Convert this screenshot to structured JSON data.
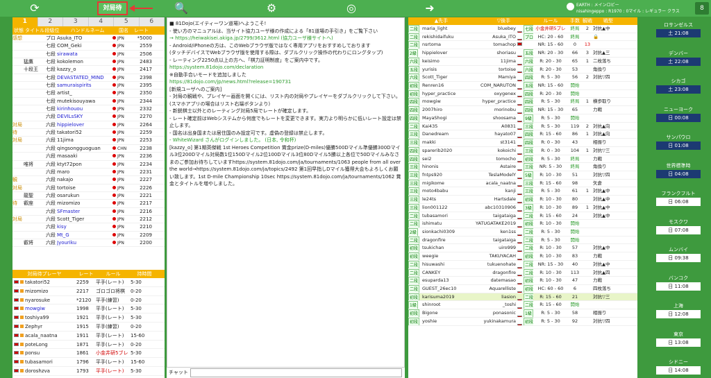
{
  "topbar": {
    "refresh_icon": "refresh-icon",
    "active_label": "対局待",
    "search_icon": "search-icon",
    "gear_icon": "gear-icon",
    "globe_icon": "globe-icon",
    "exit_icon": "exit-icon",
    "status_line1": "EARTH : メインロビー",
    "status_line2": "nisahingeppo : R1970 : 0マイル : レギュラー クラス",
    "lobby_badge": "8"
  },
  "left": {
    "tabs": [
      "1",
      "2",
      "3",
      "4",
      "5",
      "6"
    ],
    "headers": [
      "状態",
      "タイトル",
      "段級位",
      "ハンドルネーム",
      "国名",
      "レート"
    ],
    "players": [
      {
        "status": "感想",
        "title": "",
        "rank": "プロ",
        "name": "Asuka_ITO",
        "country": "JPN",
        "rate": "*5000",
        "blue": false
      },
      {
        "status": "",
        "title": "",
        "rank": "七段",
        "name": "COM_Geki",
        "country": "JPN",
        "rate": "2559",
        "blue": false
      },
      {
        "status": "",
        "title": "",
        "rank": "七段",
        "name": "sirawata",
        "country": "JPN",
        "rate": "2506",
        "blue": true
      },
      {
        "status": "",
        "title": "猛鷹",
        "rank": "七段",
        "name": "kokolemon",
        "country": "JPN",
        "rate": "2483",
        "blue": false
      },
      {
        "status": "",
        "title": "十段王",
        "rank": "七段",
        "name": "kazzy_o",
        "country": "JPN",
        "rate": "2417",
        "blue": false
      },
      {
        "status": "",
        "title": "",
        "rank": "七段",
        "name": "DEVASTATED_MIND",
        "country": "JPN",
        "rate": "2398",
        "blue": true
      },
      {
        "status": "",
        "title": "",
        "rank": "七段",
        "name": "samuraispirits",
        "country": "JPN",
        "rate": "2395",
        "blue": true
      },
      {
        "status": "",
        "title": "",
        "rank": "七段",
        "name": "artist_",
        "country": "JPN",
        "rate": "2350",
        "blue": false
      },
      {
        "status": "",
        "title": "",
        "rank": "七段",
        "name": "mutekisouyawa",
        "country": "JPN",
        "rate": "2344",
        "blue": false
      },
      {
        "status": "",
        "title": "",
        "rank": "七段",
        "name": "kirinhouou",
        "country": "JPN",
        "rate": "2332",
        "blue": true
      },
      {
        "status": "",
        "title": "",
        "rank": "六段",
        "name": "DEVILsSKY",
        "country": "JPN",
        "rate": "2270",
        "blue": true
      },
      {
        "status": "対局",
        "title": "",
        "rank": "六段",
        "name": "hippielover",
        "country": "JPN",
        "rate": "2264",
        "blue": true
      },
      {
        "status": "待",
        "title": "",
        "rank": "六段",
        "name": "takatori52",
        "country": "JPN",
        "rate": "2259",
        "blue": false
      },
      {
        "status": "対局",
        "title": "",
        "rank": "六段",
        "name": "11jima",
        "country": "JPN",
        "rate": "2253",
        "blue": false
      },
      {
        "status": "",
        "title": "",
        "rank": "六段",
        "name": "qingsongguoguan",
        "country": "CHN",
        "rate": "2238",
        "blue": false
      },
      {
        "status": "",
        "title": "",
        "rank": "六段",
        "name": "masaaki",
        "country": "JPN",
        "rate": "2236",
        "blue": false
      },
      {
        "status": "",
        "title": "唯将",
        "rank": "六段",
        "name": "ktyt72pon",
        "country": "JPN",
        "rate": "2234",
        "blue": false
      },
      {
        "status": "",
        "title": "",
        "rank": "六段",
        "name": "maro",
        "country": "JPN",
        "rate": "2231",
        "blue": false
      },
      {
        "status": "観",
        "title": "",
        "rank": "六段",
        "name": "nakajo",
        "country": "JPN",
        "rate": "2227",
        "blue": false
      },
      {
        "status": "対局",
        "title": "",
        "rank": "六段",
        "name": "tortoise",
        "country": "JPN",
        "rate": "2226",
        "blue": false
      },
      {
        "status": "",
        "title": "龍聖",
        "rank": "六段",
        "name": "osarukun",
        "country": "JPN",
        "rate": "2221",
        "blue": false
      },
      {
        "status": "待",
        "title": "叡座",
        "rank": "六段",
        "name": "mizomizo",
        "country": "JPN",
        "rate": "2217",
        "blue": false
      },
      {
        "status": "",
        "title": "",
        "rank": "六段",
        "name": "SFmaster",
        "country": "JPN",
        "rate": "2216",
        "blue": true
      },
      {
        "status": "対局",
        "title": "",
        "rank": "六段",
        "name": "Scott_Tiger",
        "country": "JPN",
        "rate": "2212",
        "blue": false
      },
      {
        "status": "",
        "title": "",
        "rank": "六段",
        "name": "kisy",
        "country": "JPN",
        "rate": "2210",
        "blue": true
      },
      {
        "status": "",
        "title": "",
        "rank": "六段",
        "name": "Mt_G",
        "country": "JPN",
        "rate": "2209",
        "blue": true
      },
      {
        "status": "",
        "title": "叡将",
        "rank": "六段",
        "name": "Jyouriku",
        "country": "JPN",
        "rate": "2200",
        "blue": true
      }
    ],
    "waiting_headers": [
      "対局待プレーヤ",
      "レート",
      "ルール",
      "持時間"
    ],
    "waiting": [
      {
        "name": "takatori52",
        "rate": "2259",
        "rule": "平手(レート)",
        "time": "5-30",
        "red": false,
        "blue": false
      },
      {
        "name": "mizomizo",
        "rate": "2217",
        "rule": "ゴロゴロ将棋",
        "time": "0-20",
        "red": false,
        "blue": false
      },
      {
        "name": "nyarosuke",
        "rate": "*2120",
        "rule": "平手(練習)",
        "time": "0-20",
        "red": false,
        "blue": false
      },
      {
        "name": "mowgiw",
        "rate": "1998",
        "rule": "平手(レート)",
        "time": "5-30",
        "red": false,
        "blue": true
      },
      {
        "name": "toshiya99",
        "rate": "1921",
        "rule": "平手(レート)",
        "time": "5-30",
        "red": false,
        "blue": false
      },
      {
        "name": "Zephyr",
        "rate": "1915",
        "rule": "平手(練習)",
        "time": "0-20",
        "red": false,
        "blue": false
      },
      {
        "name": "acala_naatna",
        "rate": "1911",
        "rule": "平手(レート)",
        "time": "15-60",
        "red": false,
        "blue": false
      },
      {
        "name": "poteLong",
        "rate": "1871",
        "rule": "平手(レート)",
        "time": "0-20",
        "red": false,
        "blue": false
      },
      {
        "name": "ponsu",
        "rate": "1861",
        "rule": "小金井研5ブレ",
        "time": "5-30",
        "red": true,
        "blue": false
      },
      {
        "name": "tubasamori",
        "rate": "1796",
        "rule": "平手(レート)",
        "time": "15-60",
        "red": false,
        "blue": false
      },
      {
        "name": "doroshzva",
        "rate": "1793",
        "rule": "平手(レート)",
        "time": "5-30",
        "red": true,
        "blue": false
      }
    ]
  },
  "middle": {
    "lines": [
      {
        "t": "■ 81Dojo(エイティーワン道場)へようこそ!",
        "c": ""
      },
      {
        "t": "- 使い方のマニュアルは、当サイト協力ユーザ様の作成による「81道場の手引き」をご覧下さい",
        "c": ""
      },
      {
        "t": "→ https://heiwakisei.akiga.jp/2799/3612.html (協力ユーザ様サイトへ)",
        "c": "lnk"
      },
      {
        "t": "- Android/iPhoneの方は、このWebブラウザ版ではなく専用アプリをおすすめしております",
        "c": ""
      },
      {
        "t": "(タッチデバイスでWebブラウザ版を使用する際は、ダブルクリック操作の代わりにロングタップ)",
        "c": ""
      },
      {
        "t": "- レーティング2250点以上の方へ、「棋力証明制度」をご案内中です。",
        "c": ""
      },
      {
        "t": "https://system.81dojo.com/declaration",
        "c": "lnk"
      },
      {
        "t": "※自動手合いモードを追加しました",
        "c": ""
      },
      {
        "t": "https://81dojo.com/jp/news.html?release=190731",
        "c": "lnk"
      },
      {
        "t": "[新規ユーザへのご案内]",
        "c": ""
      },
      {
        "t": "- 対局の観戦や、プレイヤー画面を開くには、リスト内の対局やプレイヤーをダブルクリックして下さい。(スマホアプリの場合はリスト右端ボタンより)",
        "c": ""
      },
      {
        "t": "- 新鋭棋士以外とのレーティング対局5局でレートが確定します。",
        "c": ""
      },
      {
        "t": "- レート確定前はWebシステムから何度でもレートを変更できます。実力より明らかに低いレート設定は禁止します。",
        "c": ""
      },
      {
        "t": "- 国名は出身国または居住国のみ設定可です。虚偽の登録は禁止します。",
        "c": ""
      },
      {
        "t": "- WhiteWizard さんがログインしました。 (日本, 令和杯)",
        "c": "grn"
      },
      {
        "t": "[kazzy_o] 第1期英傑戦 1st Heroes Competition 賞金prize(D-miles)優勝500Dマイル準優勝300Dマイル3位200Dマイル対局数1位150Dマイル2位100Dマイル3位80Dマイル5勝以上各位で50Dマイルみなさまのご参加お待ちしていますhttps://system.81dojo.com/ja/tournaments/1063 people from all over the world→https://system.81dojo.com/ja/topics/2492 第1回早指しDマイル獲得大会もよろしくお願い致します。1st D-mile Championship 10sec https://system.81dojo.com/ja/tournaments/1062 賞金とタイトルを増やしました。",
        "c": ""
      }
    ]
  },
  "chat": {
    "label": "チャット",
    "value": ""
  },
  "right": {
    "headers": [
      "▲先手",
      "▽後手",
      "ルール",
      "手数",
      "観戦",
      "戦型"
    ],
    "games": [
      {
        "r1": "二段",
        "p1": "maria_light",
        "p2": "bluebey",
        "r2": "七段",
        "rule": "小金井研5ブレ",
        "moves": "終局",
        "watch": "2",
        "strategy": "対抗▲中",
        "hl": false
      },
      {
        "r1": "二段",
        "p1": "rekishidaifuku",
        "p2": "Asuka_ITO",
        "r2": "プロ",
        "rule": "HC: 20 - 60",
        "moves": "終局",
        "watch": "",
        "strategy": "🔒",
        "hl": false
      },
      {
        "r1": "二段",
        "p1": "nsrtoma",
        "p2": "tomachop",
        "r2": "",
        "rule": "NR: 15 - 60",
        "moves": "0",
        "watch": "13",
        "strategy": "",
        "hl": false
      },
      {
        "r1": "2級",
        "p1": "hippielover",
        "p2": "shoriasu",
        "r2": "五段",
        "rule": "NR: 20 - 30",
        "moves": "66",
        "watch": "3",
        "strategy": "対抗▲三",
        "hl": false
      },
      {
        "r1": "六段",
        "p1": "keisimo",
        "p2": "11jima",
        "r2": "六段",
        "rule": "R: 20 - 30",
        "moves": "65",
        "watch": "1",
        "strategy": "二枚落ち",
        "hl": false
      },
      {
        "r1": "五段",
        "p1": "yurisis",
        "p2": "tortoise",
        "r2": "六段",
        "rule": "R: 20 - 30",
        "moves": "53",
        "watch": "",
        "strategy": "角換り",
        "hl": false
      },
      {
        "r1": "六段",
        "p1": "Scott_Tiger",
        "p2": "Mamiya",
        "r2": "四段",
        "rule": "R: 5 - 30",
        "moves": "56",
        "watch": "2",
        "strategy": "対抗▽四",
        "hl": false
      },
      {
        "r1": "初段",
        "p1": "Renren16",
        "p2": "COM_NARUTON",
        "r2": "五段",
        "rule": "NR: 15 - 60",
        "moves": "開始",
        "watch": "",
        "strategy": "",
        "hl": false
      },
      {
        "r1": "初段",
        "p1": "hyper_practice",
        "p2": "oxygenex",
        "r2": "四段",
        "rule": "R: 20 - 30",
        "moves": "開始",
        "watch": "",
        "strategy": "",
        "hl": false
      },
      {
        "r1": "四段",
        "p1": "mowgiw",
        "p2": "hyper_practice",
        "r2": "四段",
        "rule": "R: 5 - 30",
        "moves": "終局",
        "watch": "1",
        "strategy": "横歩取り",
        "hl": false
      },
      {
        "r1": "四段",
        "p1": "2007hiro",
        "p2": "morinobu",
        "r2": "四段",
        "rule": "NR: 15 - 30",
        "moves": "65",
        "watch": "",
        "strategy": "力戦",
        "hl": false
      },
      {
        "r1": "四段",
        "p1": "MayaShogi",
        "p2": "shoosama",
        "r2": "9級",
        "rule": "R: 5 - 30",
        "moves": "開始",
        "watch": "",
        "strategy": "",
        "hl": false
      },
      {
        "r1": "二段",
        "p1": "Kai435",
        "p2": "A0831",
        "r2": "三段",
        "rule": "R: 5 - 30",
        "moves": "119",
        "watch": "2",
        "strategy": "対抗▲向",
        "hl": false
      },
      {
        "r1": "三段",
        "p1": "Danedream",
        "p2": "hayato07",
        "r2": "四段",
        "rule": "R: 15 - 60",
        "moves": "86",
        "watch": "1",
        "strategy": "対抗▲向",
        "hl": false
      },
      {
        "r1": "三段",
        "p1": "makki",
        "p2": "st3141",
        "r2": "四段",
        "rule": "R: 0 - 30",
        "moves": "43",
        "watch": "",
        "strategy": "相振り",
        "hl": false
      },
      {
        "r1": "四段",
        "p1": "sparerib2020",
        "p2": "kokoichi",
        "r2": "三段",
        "rule": "R: 0 - 30",
        "moves": "104",
        "watch": "1",
        "strategy": "対抗▽三",
        "hl": false
      },
      {
        "r1": "四段",
        "p1": "sei2",
        "p2": "tomocho",
        "r2": "初段",
        "rule": "R: 5 - 30",
        "moves": "終局",
        "watch": "",
        "strategy": "力戦",
        "hl": false
      },
      {
        "r1": "三段",
        "p1": "hinonis",
        "p2": "Astaire",
        "r2": "三段",
        "rule": "NR: 5 - 30",
        "moves": "終局",
        "watch": "",
        "strategy": "角換り",
        "hl": false
      },
      {
        "r1": "三段",
        "p1": "fntps920",
        "p2": "TeslaModelY",
        "r2": "5級",
        "rule": "R: 10 - 30",
        "moves": "51",
        "watch": "",
        "strategy": "対抗▽四",
        "hl": false
      },
      {
        "r1": "三段",
        "p1": "migikome",
        "p2": "acala_naatna",
        "r2": "三段",
        "rule": "R: 15 - 60",
        "moves": "98",
        "watch": "",
        "strategy": "矢倉",
        "hl": false
      },
      {
        "r1": "三段",
        "p1": "moto4babu",
        "p2": "kanji",
        "r2": "三段",
        "rule": "R: 5 - 30",
        "moves": "61",
        "watch": "1",
        "strategy": "対抗▲中",
        "hl": false
      },
      {
        "r1": "三段",
        "p1": "le24ts",
        "p2": "Hartsdale",
        "r2": "初段",
        "rule": "R: 10 - 30",
        "moves": "80",
        "watch": "",
        "strategy": "対抗▲中",
        "hl": false
      },
      {
        "r1": "三段",
        "p1": "lion001122",
        "p2": "abc10310906",
        "r2": "3級",
        "rule": "R: 10 - 30",
        "moves": "89",
        "watch": "1",
        "strategy": "対抗▲中",
        "hl": false
      },
      {
        "r1": "二段",
        "p1": "tubasamori",
        "p2": "taigataiga",
        "r2": "二段",
        "rule": "R: 15 - 60",
        "moves": "24",
        "watch": "",
        "strategy": "対抗▲中",
        "hl": false
      },
      {
        "r1": "二段",
        "p1": "ishimatu",
        "p2": "YATUGATAKE2019",
        "r2": "初段",
        "rule": "R: 10 - 30",
        "moves": "開始",
        "watch": "",
        "strategy": "",
        "hl": false
      },
      {
        "r1": "2級",
        "p1": "sionkachi0309",
        "p2": "ken1ss",
        "r2": "二段",
        "rule": "R: 5 - 30",
        "moves": "開始",
        "watch": "",
        "strategy": "",
        "hl": false
      },
      {
        "r1": "二段",
        "p1": "dragonfire",
        "p2": "taigataiga",
        "r2": "二段",
        "rule": "R: 5 - 30",
        "moves": "開始",
        "watch": "",
        "strategy": "",
        "hl": false
      },
      {
        "r1": "初段",
        "p1": "tsukichan",
        "p2": "uiro999",
        "r2": "二段",
        "rule": "R: 10 - 30",
        "moves": "57",
        "watch": "",
        "strategy": "対抗▲中",
        "hl": false
      },
      {
        "r1": "初段",
        "p1": "weegie",
        "p2": "TAKUYACAH",
        "r2": "初段",
        "rule": "R: 10 - 30",
        "moves": "83",
        "watch": "",
        "strategy": "力戦",
        "hl": false
      },
      {
        "r1": "二段",
        "p1": "hisuwashi",
        "p2": "tukuenohate",
        "r2": "二段",
        "rule": "NR: 15 - 30",
        "moves": "40",
        "watch": "",
        "strategy": "対抗▲中",
        "hl": false
      },
      {
        "r1": "二段",
        "p1": "CANKEY",
        "p2": "dragonfire",
        "r2": "二段",
        "rule": "R: 10 - 30",
        "moves": "113",
        "watch": "",
        "strategy": "対抗▲四",
        "hl": false
      },
      {
        "r1": "二段",
        "p1": "esuparda13",
        "p2": "datemasao",
        "r2": "初段",
        "rule": "R: 10 - 30",
        "moves": "47",
        "watch": "",
        "strategy": "力戦",
        "hl": false
      },
      {
        "r1": "二段",
        "p1": "GUEST_26ec10",
        "p2": "Aquarelliste",
        "r2": "初段",
        "rule": "HC: 60 - 60",
        "moves": "6",
        "watch": "",
        "strategy": "四枚落ち",
        "hl": false
      },
      {
        "r1": "初段",
        "p1": "karisuma2019",
        "p2": "liasion",
        "r2": "二段",
        "rule": "R: 15 - 60",
        "moves": "21",
        "watch": "",
        "strategy": "対抗▽三",
        "hl": true
      },
      {
        "r1": "1級",
        "p1": "shinroot",
        "p2": "_toshi",
        "r2": "二段",
        "rule": "R: 15 - 60",
        "moves": "開始",
        "watch": "",
        "strategy": "",
        "hl": false
      },
      {
        "r1": "初段",
        "p1": "Bigone",
        "p2": "ponasonic",
        "r2": "1級",
        "rule": "R: 5 - 30",
        "moves": "58",
        "watch": "",
        "strategy": "相振り",
        "hl": false
      },
      {
        "r1": "初段",
        "p1": "yoshie",
        "p2": "yukinakamura",
        "r2": "初段",
        "rule": "R: 5 - 30",
        "moves": "92",
        "watch": "",
        "strategy": "対抗▽四",
        "hl": false
      }
    ]
  },
  "clocks": [
    {
      "city": "ロサンゼルス",
      "time": "土 21:08",
      "night": true
    },
    {
      "city": "デンバー",
      "time": "土 22:08",
      "night": true
    },
    {
      "city": "シカゴ",
      "time": "土 23:08",
      "night": true
    },
    {
      "city": "ニューヨーク",
      "time": "日 00:08",
      "night": true
    },
    {
      "city": "サンパウロ",
      "time": "日 01:08",
      "night": true
    },
    {
      "city": "世界標準時",
      "time": "日 04:08",
      "night": true
    },
    {
      "city": "フランクフルト",
      "time": "日 06:08",
      "night": false
    },
    {
      "city": "モスクワ",
      "time": "日 07:08",
      "night": false
    },
    {
      "city": "ムンバイ",
      "time": "日 09:38",
      "night": false
    },
    {
      "city": "バンコク",
      "time": "日 11:08",
      "night": false
    },
    {
      "city": "上海",
      "time": "日 12:08",
      "night": false
    },
    {
      "city": "東京",
      "time": "日 13:08",
      "night": false
    },
    {
      "city": "シドニー",
      "time": "日 14:08",
      "night": false
    }
  ],
  "colors": {
    "accent": "#f5b400",
    "topbar": "#4caf50",
    "background": "#3e9a3e",
    "highlight": "#e53935",
    "rank_fill": "#eeffee",
    "blue_name": "#1a1ad0",
    "red_name": "#d00000"
  }
}
